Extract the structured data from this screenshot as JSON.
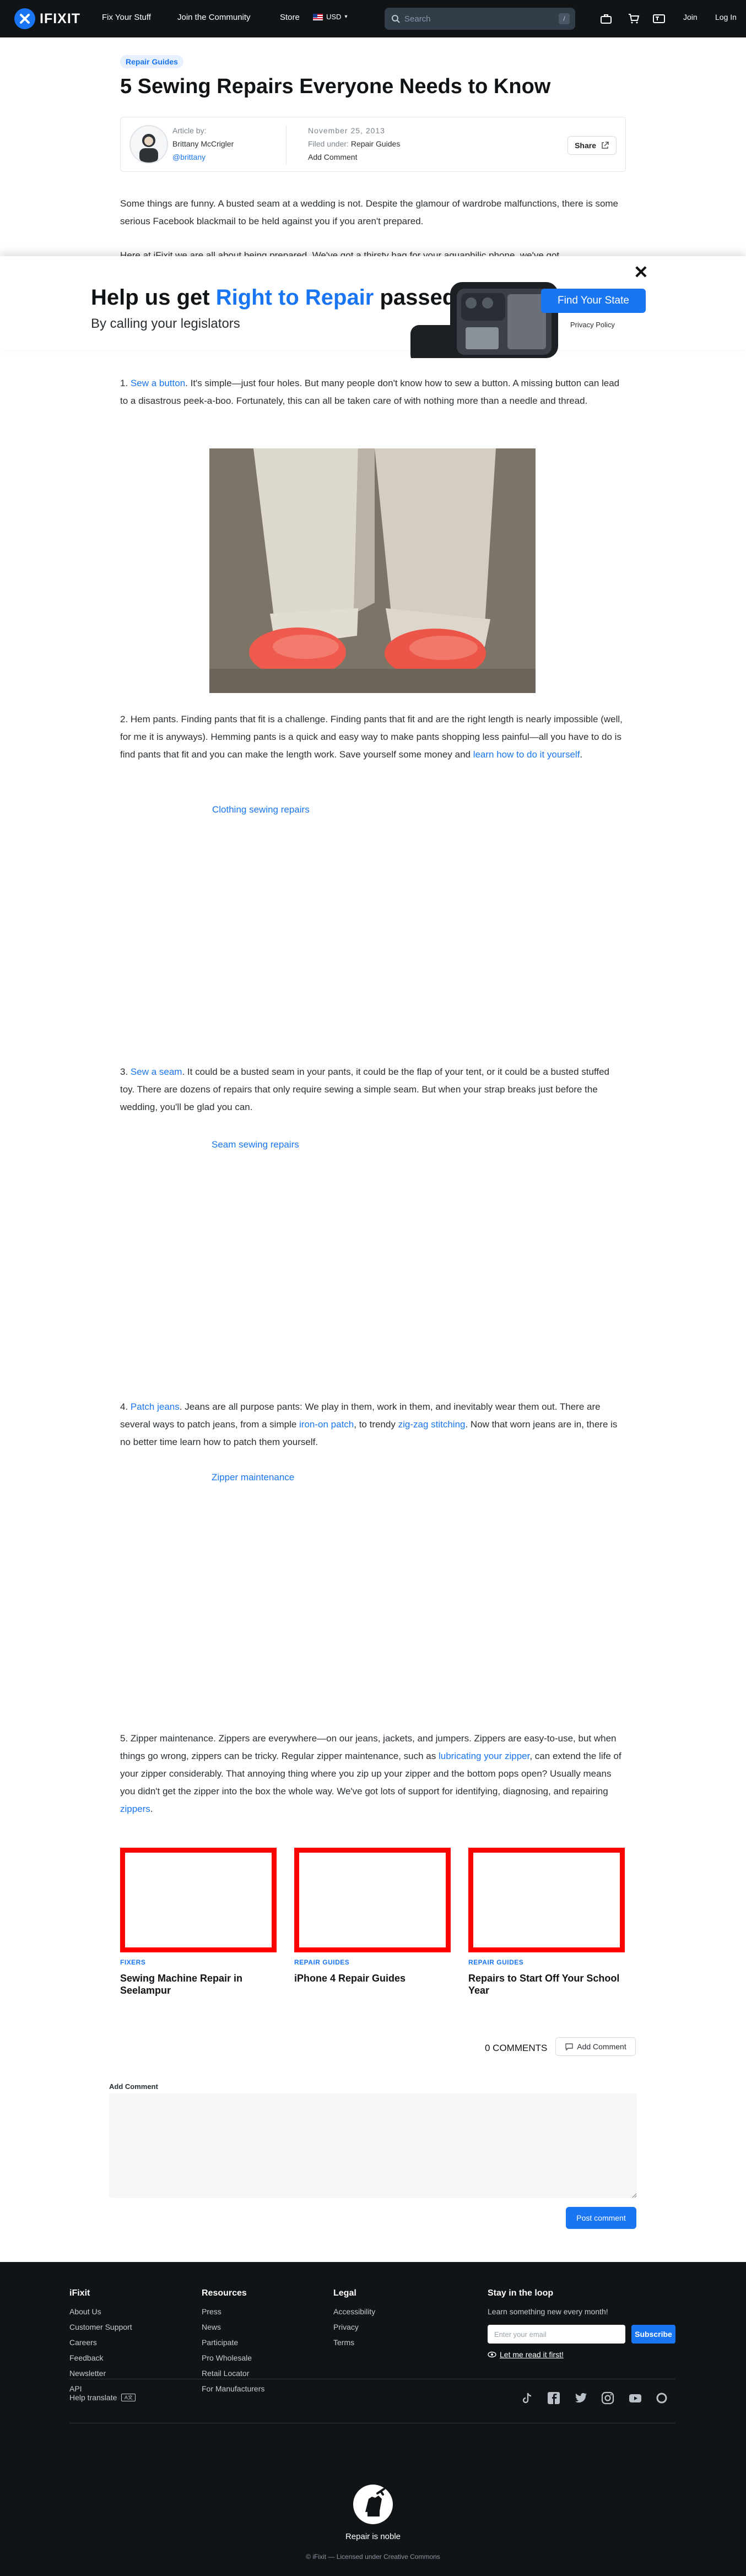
{
  "nav": {
    "logo_text": "IFIXIT",
    "links": [
      "Fix Your Stuff",
      "Join the Community",
      "Store"
    ],
    "region": "USD",
    "search_placeholder": "Search",
    "search_shortcut": "/",
    "join": "Join",
    "login": "Log In"
  },
  "article": {
    "badge": "Repair Guides",
    "title": "5 Sewing Repairs Everyone Needs to Know",
    "article_by_label": "Article by:",
    "author": "Brittany McCrigler",
    "handle": "@brittany",
    "date": "November 25, 2013",
    "filed_label": "Filed under:",
    "filed_value": "Repair Guides",
    "add_comment": "Add Comment",
    "share": "Share",
    "intro": "Some things are funny. A busted seam at a wedding is not. Despite the glamour of wardrobe malfunctions, there is some serious Facebook blackmail to be held against you if you aren't prepared.",
    "intro2": "Here at iFixit we are all about being prepared. We've got a thirsty bag for your aquaphilic phone, we've got"
  },
  "overlay": {
    "close": "✕",
    "heading_prefix": "Help us get ",
    "heading_highlight": "Right to Repair",
    "heading_suffix": " passed",
    "sub": "By calling your legislators",
    "find_button": "Find Your State",
    "privacy": "Privacy Policy"
  },
  "sections": {
    "s1_num": "1. ",
    "s1_link": "Sew a button",
    "s1_text": ". It's simple—just four holes. But many people don't know how to sew a button. A missing button can lead to a disastrous peek-a-boo. Fortunately, this can all be taken care of with nothing more than a needle and thread.",
    "s2_text": "2. Hem pants. Finding pants that fit is a challenge. Finding pants that fit and are the right length is nearly impossible (well, for me it is anyways). Hemming pants is a quick and easy way to make pants shopping less painful—all you have to do is find pants that fit and you can make the length work. Save yourself some money and ",
    "s2_link": "learn how to do it yourself",
    "s2_end": ".",
    "s2_caption": "Clothing sewing repairs",
    "s3_num": "3. ",
    "s3_link": "Sew a seam",
    "s3_text": ". It could be a busted seam in your pants, it could be the flap of your tent, or it could be a busted stuffed toy. There are dozens of repairs that only require sewing a simple seam. But when your strap breaks just before the wedding, you'll be glad you can.",
    "s3_caption": "Seam sewing repairs",
    "s4_num": "4. ",
    "s4_link": "Patch jeans",
    "s4_text_a": ". Jeans are all purpose pants: We play in them, work in them, and inevitably wear them out. There are several ways to patch jeans, from a simple ",
    "s4_link2": "iron-on patch",
    "s4_text_b": ", to trendy ",
    "s4_link3": "zig-zag stitching",
    "s4_text_c": ". Now that worn jeans are in, there is no better time learn how to patch them yourself.",
    "s4_caption": "Zipper maintenance",
    "s5_text_a": "5. Zipper maintenance. Zippers are everywhere—on our jeans, jackets, and jumpers. Zippers are easy-to-use, but when things go wrong, zippers can be tricky. Regular zipper maintenance, such as ",
    "s5_link": "lubricating your zipper",
    "s5_text_b": ", can extend the life of your zipper considerably. That annoying thing where you zip up your zipper and the bottom pops open? Usually means you didn't get the zipper into the box the whole way. We've got lots of support for identifying, diagnosing, and repairing ",
    "s5_link2": "zippers",
    "s5_end": "."
  },
  "related": [
    {
      "tag": "FIXERS",
      "title": "Sewing Machine Repair in Seelampur"
    },
    {
      "tag": "REPAIR GUIDES",
      "title": "iPhone 4 Repair Guides"
    },
    {
      "tag": "REPAIR GUIDES",
      "title": "Repairs to Start Off Your School Year"
    }
  ],
  "comments": {
    "count": "0 COMMENTS",
    "add_button": "Add Comment",
    "label": "Add Comment",
    "post": "Post comment"
  },
  "footer": {
    "col1_title": "iFixit",
    "col1": [
      "About Us",
      "Customer Support",
      "Careers",
      "Feedback",
      "Newsletter",
      "API"
    ],
    "col2_title": "Resources",
    "col2": [
      "Press",
      "News",
      "Participate",
      "Pro Wholesale",
      "Retail Locator",
      "For Manufacturers"
    ],
    "col3_title": "Legal",
    "col3": [
      "Accessibility",
      "Privacy",
      "Terms"
    ],
    "col4_title": "Stay in the loop",
    "col4_text": "Learn something new every month!",
    "email_placeholder": "Enter your email",
    "subscribe": "Subscribe",
    "read_first": "Let me read it first!",
    "help_translate": "Help translate",
    "tagline": "Repair is noble",
    "license": "© iFixit — Licensed under Creative Commons"
  },
  "colors": {
    "brand": "#1975f1",
    "nav": "#111417",
    "card_border": "#ff0000"
  }
}
